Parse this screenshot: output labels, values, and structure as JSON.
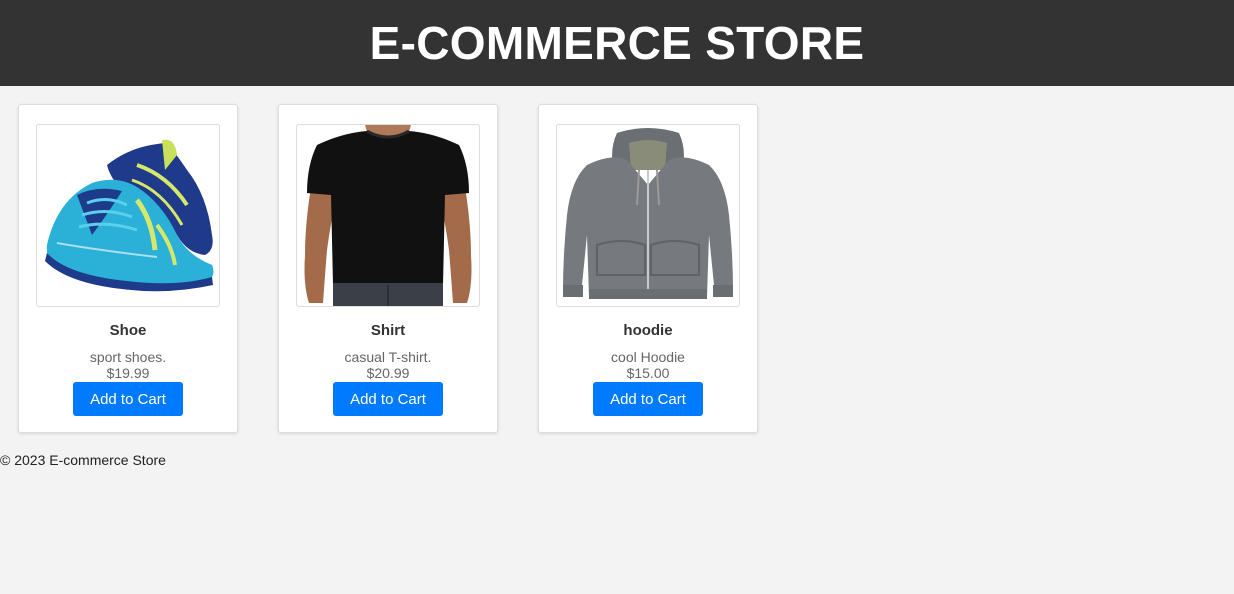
{
  "header": {
    "title": "E-COMMERCE STORE",
    "background": "#333333"
  },
  "products": [
    {
      "name": "Shoe",
      "description": "sport shoes.",
      "price": "$19.99",
      "button_label": "Add to Cart",
      "image_icon": "sneaker-image"
    },
    {
      "name": "Shirt",
      "description": "casual T-shirt.",
      "price": "$20.99",
      "button_label": "Add to Cart",
      "image_icon": "tshirt-image"
    },
    {
      "name": "hoodie",
      "description": "cool Hoodie",
      "price": "$15.00",
      "button_label": "Add to Cart",
      "image_icon": "hoodie-image"
    }
  ],
  "footer": {
    "text": "© 2023 E-commerce Store"
  },
  "colors": {
    "accent": "#007bff",
    "page_background": "#f3f3f3"
  }
}
